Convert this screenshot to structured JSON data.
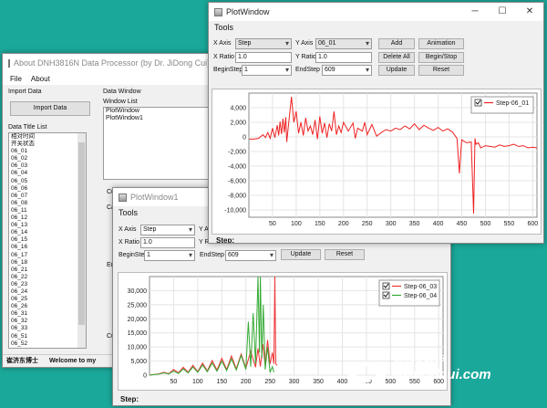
{
  "main_window": {
    "title": "About DNH3816N Data Processor (by Dr. JiDong Cui)@...",
    "menu": [
      "File",
      "About"
    ],
    "import_data_label": "Import Data",
    "import_button": "Import Data",
    "data_title_list_label": "Data Title List",
    "data_titles": [
      "相对时间",
      "开关状态",
      "06_01",
      "06_02",
      "06_03",
      "06_04",
      "06_05",
      "06_06",
      "06_07",
      "06_08",
      "06_11",
      "06_12",
      "06_13",
      "06_14",
      "06_15",
      "06_16",
      "06_17",
      "06_18",
      "06_21",
      "06_22",
      "06_23",
      "06_24",
      "06_25",
      "06_26",
      "06_31",
      "06_32",
      "06_33",
      "06_51",
      "06_52"
    ],
    "data_window_label": "Data Window",
    "window_list_label": "Window List",
    "window_list": [
      "PlotWindow",
      "PlotWindow1"
    ],
    "partial_labels": [
      "Cu",
      "Ca",
      "En",
      "Cu"
    ],
    "status_author": "崔济东博士",
    "status_welcome": "Welcome to my"
  },
  "plot_window": {
    "title": "PlotWindow",
    "controls": [
      "─",
      "☐",
      "✕"
    ],
    "tools_label": "Tools",
    "x_axis_label": "X Axis",
    "x_axis_value": "Step",
    "y_axis_label": "Y Axis",
    "y_axis_value": "06_01",
    "x_ratio_label": "X Ratio",
    "x_ratio_value": "1.0",
    "y_ratio_label": "Y Ratio",
    "y_ratio_value": "1.0",
    "begin_step_label": "BeginStep",
    "begin_step_value": "1",
    "end_step_label": "EndStep",
    "end_step_value": "609",
    "buttons": {
      "add": "Add",
      "animation": "Animation",
      "delete_all": "Delete All",
      "begin_stop": "Begin/Stop",
      "update": "Update",
      "reset": "Reset"
    },
    "status_label": "Step:"
  },
  "plot_window1": {
    "title": "PlotWindow1",
    "tools_label": "Tools",
    "x_axis_label": "X Axis",
    "x_axis_value": "Step",
    "y_axis_label": "Y A",
    "x_ratio_label": "X Ratio",
    "x_ratio_value": "1.0",
    "y_ratio_label": "Y R",
    "begin_step_label": "BeginStep",
    "begin_step_value": "1",
    "end_step_label": "EndStep",
    "end_step_value": "609",
    "buttons": {
      "update": "Update",
      "reset": "Reset"
    },
    "status_label": "Step:"
  },
  "watermark": {
    "since": "SINCE 2015",
    "url": "www.jdcui.com"
  },
  "chart_data": [
    {
      "type": "line",
      "title": "",
      "xlabel": "",
      "ylabel": "",
      "xlim": [
        0,
        609
      ],
      "ylim": [
        -11000,
        6000
      ],
      "xticks": [
        50,
        100,
        150,
        200,
        250,
        300,
        350,
        400,
        450,
        500,
        550,
        600
      ],
      "yticks": [
        4000,
        2000,
        0,
        -2000,
        -4000,
        -6000,
        -8000,
        -10000
      ],
      "ytick_labels": [
        "4,000",
        "2,000",
        "0",
        "-2,000",
        "-4,000",
        "-6,000",
        "-8,000",
        "-10,000"
      ],
      "grid": true,
      "legend": "top-right",
      "series": [
        {
          "name": "Step-06_01",
          "color": "#ee2222",
          "x": [
            1,
            10,
            20,
            30,
            35,
            40,
            45,
            50,
            55,
            60,
            63,
            66,
            69,
            72,
            75,
            78,
            80,
            85,
            90,
            95,
            100,
            105,
            110,
            115,
            120,
            125,
            130,
            135,
            140,
            145,
            150,
            155,
            160,
            165,
            170,
            175,
            180,
            185,
            190,
            195,
            200,
            210,
            220,
            225,
            230,
            240,
            245,
            250,
            260,
            270,
            280,
            290,
            300,
            310,
            320,
            330,
            340,
            350,
            360,
            370,
            380,
            390,
            400,
            410,
            420,
            430,
            440,
            445,
            448,
            450,
            455,
            460,
            470,
            475,
            478,
            480,
            485,
            490,
            500,
            510,
            520,
            530,
            540,
            550,
            560,
            570,
            580,
            590,
            600,
            609
          ],
          "y": [
            -300,
            -300,
            -200,
            300,
            -100,
            600,
            -200,
            1200,
            -100,
            1600,
            200,
            2100,
            400,
            2500,
            600,
            2700,
            -700,
            2400,
            5500,
            2000,
            3500,
            500,
            2000,
            200,
            2600,
            800,
            1500,
            300,
            2300,
            -300,
            2800,
            500,
            1900,
            -100,
            1800,
            800,
            3500,
            300,
            1500,
            600,
            2000,
            800,
            1900,
            -200,
            1200,
            800,
            2000,
            300,
            1700,
            100,
            600,
            1000,
            800,
            1200,
            1000,
            1500,
            1100,
            1800,
            1000,
            1600,
            1200,
            900,
            1300,
            800,
            1100,
            700,
            -200,
            -5000,
            -2000,
            -400,
            -600,
            -800,
            -700,
            -10500,
            -200,
            -1000,
            -800,
            -1500,
            -1200,
            -1300,
            -1400,
            -1100,
            -1300,
            -1200,
            -1000,
            -1300,
            -1200,
            -1500,
            -1400,
            -1500
          ]
        }
      ]
    },
    {
      "type": "line",
      "title": "",
      "xlabel": "",
      "ylabel": "",
      "xlim": [
        0,
        609
      ],
      "ylim": [
        0,
        35000
      ],
      "xticks": [
        50,
        100,
        150,
        200,
        250,
        300,
        350,
        400,
        450,
        500,
        550,
        600
      ],
      "yticks": [
        0,
        5000,
        10000,
        15000,
        20000,
        25000,
        30000
      ],
      "ytick_labels": [
        "0",
        "5,000",
        "10,000",
        "15,000",
        "20,000",
        "25,000",
        "30,000"
      ],
      "grid": true,
      "legend": "top-right",
      "series": [
        {
          "name": "Step-06_03",
          "color": "#ee3333",
          "x": [
            0,
            20,
            30,
            40,
            50,
            60,
            70,
            80,
            90,
            100,
            110,
            120,
            130,
            140,
            150,
            160,
            170,
            180,
            190,
            200,
            210,
            220,
            225,
            230,
            235,
            240,
            245,
            250,
            255,
            258,
            260,
            262,
            265
          ],
          "y": [
            0,
            500,
            1000,
            500,
            2000,
            800,
            2800,
            1000,
            3500,
            1200,
            4300,
            1500,
            5200,
            1800,
            6000,
            2000,
            6800,
            2200,
            7500,
            2500,
            8500,
            2800,
            9500,
            3000,
            11000,
            3500,
            12500,
            4000,
            8000,
            4000,
            36000,
            4000,
            3500
          ]
        },
        {
          "name": "Step-06_04",
          "color": "#33aa33",
          "x": [
            0,
            20,
            30,
            40,
            50,
            60,
            70,
            80,
            90,
            100,
            110,
            120,
            130,
            140,
            150,
            160,
            170,
            180,
            190,
            200,
            205,
            210,
            215,
            220,
            225,
            228,
            230,
            233,
            236,
            240,
            245,
            250,
            255,
            258
          ],
          "y": [
            0,
            400,
            800,
            400,
            1500,
            600,
            2200,
            800,
            2900,
            1000,
            3600,
            1200,
            4300,
            1400,
            5000,
            1600,
            5800,
            1800,
            7000,
            2000,
            19000,
            3000,
            22000,
            4000,
            36000,
            8000,
            36000,
            6000,
            25000,
            2000,
            10000,
            1000,
            3000,
            1000
          ]
        }
      ]
    }
  ]
}
